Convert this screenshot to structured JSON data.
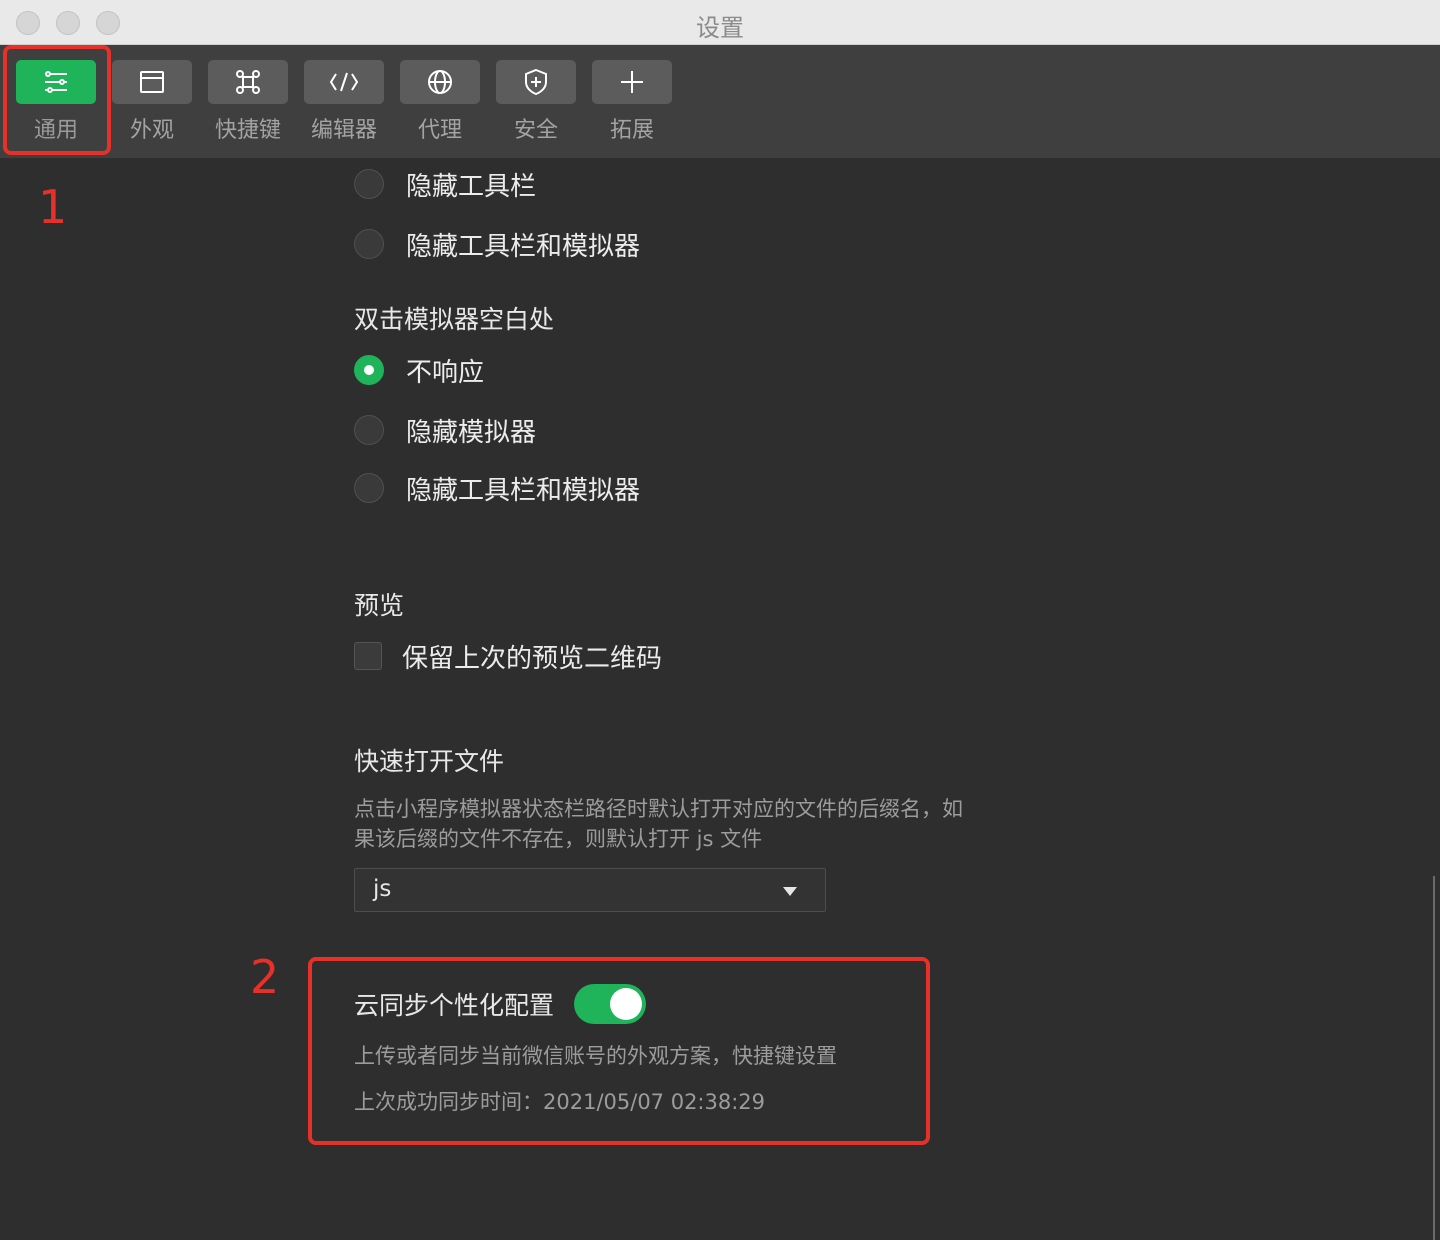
{
  "window": {
    "title": "设置"
  },
  "toolbar": {
    "tabs": [
      {
        "label": "通用",
        "icon": "sliders-icon",
        "active": true
      },
      {
        "label": "外观",
        "icon": "window-icon",
        "active": false
      },
      {
        "label": "快捷键",
        "icon": "command-key-icon",
        "active": false
      },
      {
        "label": "编辑器",
        "icon": "code-icon",
        "active": false
      },
      {
        "label": "代理",
        "icon": "globe-icon",
        "active": false
      },
      {
        "label": "安全",
        "icon": "shield-icon",
        "active": false
      },
      {
        "label": "拓展",
        "icon": "plus-icon",
        "active": false
      }
    ]
  },
  "annotations": {
    "one": "1",
    "two": "2"
  },
  "content": {
    "top_options": [
      {
        "label": "隐藏工具栏",
        "checked": false
      },
      {
        "label": "隐藏工具栏和模拟器",
        "checked": false
      }
    ],
    "dblclick": {
      "title": "双击模拟器空白处",
      "options": [
        {
          "label": "不响应",
          "checked": true
        },
        {
          "label": "隐藏模拟器",
          "checked": false
        },
        {
          "label": "隐藏工具栏和模拟器",
          "checked": false
        }
      ]
    },
    "preview": {
      "title": "预览",
      "checkbox_label": "保留上次的预览二维码",
      "checked": false
    },
    "quick_open": {
      "title": "快速打开文件",
      "desc_line1": "点击小程序模拟器状态栏路径时默认打开对应的文件的后缀名，如",
      "desc_line2": "果该后缀的文件不存在，则默认打开 js 文件",
      "select_value": "js"
    },
    "cloud_sync": {
      "title": "云同步个性化配置",
      "enabled": true,
      "desc": "上传或者同步当前微信账号的外观方案，快捷键设置",
      "last_sync": "上次成功同步时间：2021/05/07 02:38:29"
    }
  },
  "colors": {
    "accent": "#1fb35a",
    "annotation": "#e8302a",
    "background": "#2e2e2e"
  }
}
